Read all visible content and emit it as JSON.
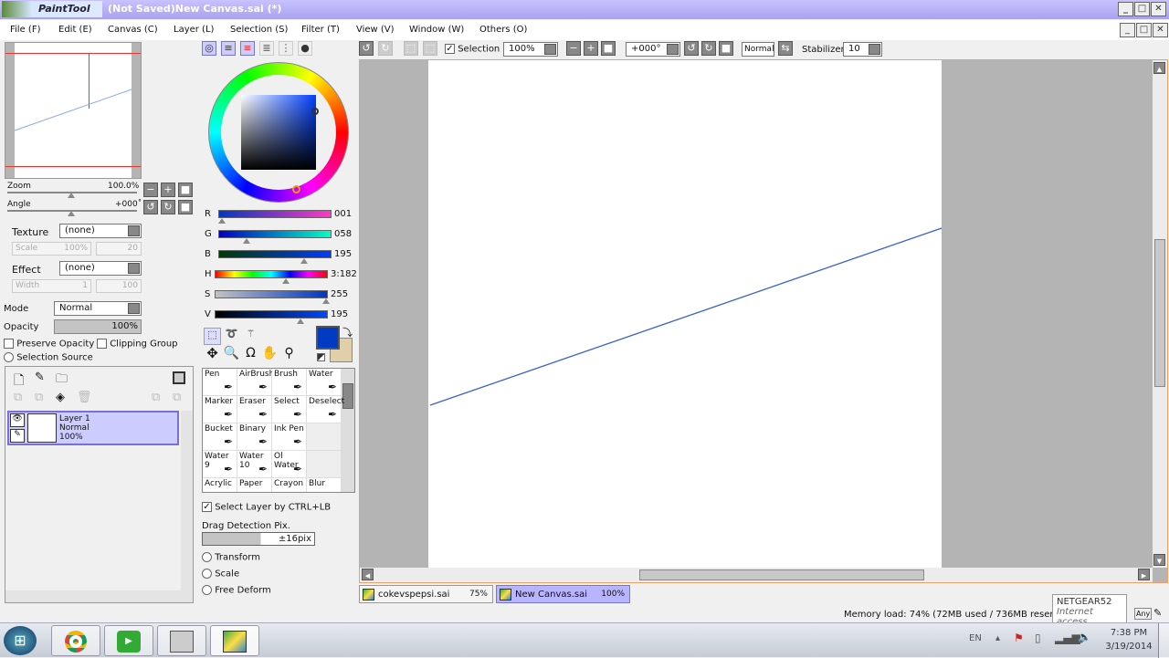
{
  "window": {
    "app_logo": "PaintTool SAI",
    "title": "(Not Saved)New Canvas.sai (*)"
  },
  "menu": [
    "File (F)",
    "Edit (E)",
    "Canvas (C)",
    "Layer (L)",
    "Selection (S)",
    "Filter (T)",
    "View (V)",
    "Window (W)",
    "Others (O)"
  ],
  "navigator": {
    "zoom_label": "Zoom",
    "zoom_value": "100.0%",
    "angle_label": "Angle",
    "angle_value": "+000˚"
  },
  "brush_settings": {
    "texture_label": "Texture",
    "texture_value": "(none)",
    "scale_label": "Scale",
    "scale_value": "100%",
    "scale_strength": "20",
    "effect_label": "Effect",
    "effect_value": "(none)",
    "width_label": "Width",
    "width_value": "1",
    "width_strength": "100"
  },
  "layer_props": {
    "mode_label": "Mode",
    "mode_value": "Normal",
    "opacity_label": "Opacity",
    "opacity_value": "100%",
    "opacity_percent": 100,
    "preserve_opacity": "Preserve Opacity",
    "clipping_group": "Clipping Group",
    "selection_source": "Selection Source"
  },
  "layers": [
    {
      "name": "Layer 1",
      "mode": "Normal",
      "opacity": "100%",
      "selected": true
    }
  ],
  "color": {
    "primary": "#013ac3",
    "secondary": "#e0cfa8",
    "sliders": [
      {
        "label": "R",
        "value": "001",
        "pos": 0.004
      },
      {
        "label": "G",
        "value": "058",
        "pos": 0.23
      },
      {
        "label": "B",
        "value": "195",
        "pos": 0.76
      },
      {
        "label": "H",
        "value": "3:182",
        "pos": 0.63
      },
      {
        "label": "S",
        "value": "255",
        "pos": 1.0
      },
      {
        "label": "V",
        "value": "195",
        "pos": 0.76
      }
    ]
  },
  "tools": [
    {
      "name": "Pen"
    },
    {
      "name": "AirBrush"
    },
    {
      "name": "Brush"
    },
    {
      "name": "Water"
    },
    {
      "name": "Marker"
    },
    {
      "name": "Eraser"
    },
    {
      "name": "Select"
    },
    {
      "name": "Deselect"
    },
    {
      "name": "Bucket"
    },
    {
      "name": "Binary"
    },
    {
      "name": "Ink Pen"
    },
    {
      "name": ""
    },
    {
      "name": "Water",
      "size": "9"
    },
    {
      "name": "Water",
      "size": "10"
    },
    {
      "name": "Ol Water"
    },
    {
      "name": ""
    },
    {
      "name": "Acrylic"
    },
    {
      "name": "Paper"
    },
    {
      "name": "Crayon"
    },
    {
      "name": "Blur"
    }
  ],
  "tool_options": {
    "select_layer": "Select Layer by CTRL+LB",
    "drag_label": "Drag Detection Pix.",
    "drag_value": "±16pix",
    "transform": "Transform",
    "scale": "Scale",
    "free_deform": "Free Deform"
  },
  "canvas_toolbar": {
    "selection_label": "Selection",
    "zoom": "100%",
    "angle": "+000°",
    "blend": "Normal",
    "stabilizer_label": "Stabilizer",
    "stabilizer": "10"
  },
  "canvas_tabs": [
    {
      "name": "cokevspepsi.sai",
      "zoom": "75%"
    },
    {
      "name": "New Canvas.sai",
      "zoom": "100%",
      "active": true
    }
  ],
  "status": {
    "memory": "Memory load: 74% (72MB used / 736MB reserved)",
    "any": "Any"
  },
  "tooltip": {
    "network": "NETGEAR52",
    "access": "Internet access"
  },
  "taskbar": {
    "lang": "EN",
    "time": "7:38 PM",
    "date": "3/19/2014"
  }
}
